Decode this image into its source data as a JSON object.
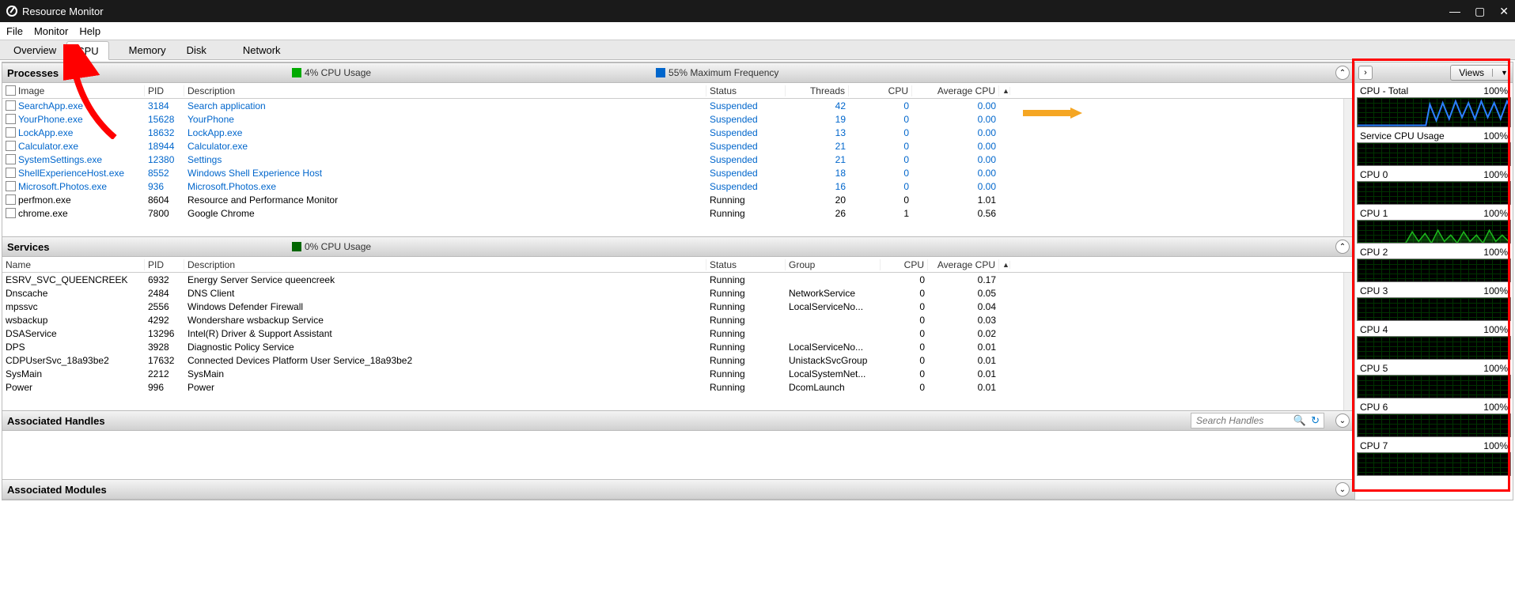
{
  "window": {
    "title": "Resource Monitor"
  },
  "menu": [
    "File",
    "Monitor",
    "Help"
  ],
  "tabs": [
    {
      "label": "Overview",
      "active": false
    },
    {
      "label": "CPU",
      "active": true
    },
    {
      "label": "Memory",
      "active": false
    },
    {
      "label": "Disk",
      "active": false
    },
    {
      "label": "Network",
      "active": false
    }
  ],
  "processes": {
    "title": "Processes",
    "usage": "4% CPU Usage",
    "freq": "55% Maximum Frequency",
    "headers": {
      "image": "Image",
      "pid": "PID",
      "desc": "Description",
      "status": "Status",
      "threads": "Threads",
      "cpu": "CPU",
      "avg": "Average CPU"
    },
    "rows": [
      {
        "image": "SearchApp.exe",
        "pid": "3184",
        "desc": "Search application",
        "status": "Suspended",
        "threads": "42",
        "cpu": "0",
        "avg": "0.00",
        "sus": true
      },
      {
        "image": "YourPhone.exe",
        "pid": "15628",
        "desc": "YourPhone",
        "status": "Suspended",
        "threads": "19",
        "cpu": "0",
        "avg": "0.00",
        "sus": true
      },
      {
        "image": "LockApp.exe",
        "pid": "18632",
        "desc": "LockApp.exe",
        "status": "Suspended",
        "threads": "13",
        "cpu": "0",
        "avg": "0.00",
        "sus": true
      },
      {
        "image": "Calculator.exe",
        "pid": "18944",
        "desc": "Calculator.exe",
        "status": "Suspended",
        "threads": "21",
        "cpu": "0",
        "avg": "0.00",
        "sus": true
      },
      {
        "image": "SystemSettings.exe",
        "pid": "12380",
        "desc": "Settings",
        "status": "Suspended",
        "threads": "21",
        "cpu": "0",
        "avg": "0.00",
        "sus": true
      },
      {
        "image": "ShellExperienceHost.exe",
        "pid": "8552",
        "desc": "Windows Shell Experience Host",
        "status": "Suspended",
        "threads": "18",
        "cpu": "0",
        "avg": "0.00",
        "sus": true
      },
      {
        "image": "Microsoft.Photos.exe",
        "pid": "936",
        "desc": "Microsoft.Photos.exe",
        "status": "Suspended",
        "threads": "16",
        "cpu": "0",
        "avg": "0.00",
        "sus": true
      },
      {
        "image": "perfmon.exe",
        "pid": "8604",
        "desc": "Resource and Performance Monitor",
        "status": "Running",
        "threads": "20",
        "cpu": "0",
        "avg": "1.01",
        "sus": false
      },
      {
        "image": "chrome.exe",
        "pid": "7800",
        "desc": "Google Chrome",
        "status": "Running",
        "threads": "26",
        "cpu": "1",
        "avg": "0.56",
        "sus": false
      }
    ]
  },
  "services": {
    "title": "Services",
    "usage": "0% CPU Usage",
    "headers": {
      "name": "Name",
      "pid": "PID",
      "desc": "Description",
      "status": "Status",
      "group": "Group",
      "cpu": "CPU",
      "avg": "Average CPU"
    },
    "rows": [
      {
        "name": "ESRV_SVC_QUEENCREEK",
        "pid": "6932",
        "desc": "Energy Server Service queencreek",
        "status": "Running",
        "group": "",
        "cpu": "0",
        "avg": "0.17"
      },
      {
        "name": "Dnscache",
        "pid": "2484",
        "desc": "DNS Client",
        "status": "Running",
        "group": "NetworkService",
        "cpu": "0",
        "avg": "0.05"
      },
      {
        "name": "mpssvc",
        "pid": "2556",
        "desc": "Windows Defender Firewall",
        "status": "Running",
        "group": "LocalServiceNo...",
        "cpu": "0",
        "avg": "0.04"
      },
      {
        "name": "wsbackup",
        "pid": "4292",
        "desc": "Wondershare wsbackup Service",
        "status": "Running",
        "group": "",
        "cpu": "0",
        "avg": "0.03"
      },
      {
        "name": "DSAService",
        "pid": "13296",
        "desc": "Intel(R) Driver & Support Assistant",
        "status": "Running",
        "group": "",
        "cpu": "0",
        "avg": "0.02"
      },
      {
        "name": "DPS",
        "pid": "3928",
        "desc": "Diagnostic Policy Service",
        "status": "Running",
        "group": "LocalServiceNo...",
        "cpu": "0",
        "avg": "0.01"
      },
      {
        "name": "CDPUserSvc_18a93be2",
        "pid": "17632",
        "desc": "Connected Devices Platform User Service_18a93be2",
        "status": "Running",
        "group": "UnistackSvcGroup",
        "cpu": "0",
        "avg": "0.01"
      },
      {
        "name": "SysMain",
        "pid": "2212",
        "desc": "SysMain",
        "status": "Running",
        "group": "LocalSystemNet...",
        "cpu": "0",
        "avg": "0.01"
      },
      {
        "name": "Power",
        "pid": "996",
        "desc": "Power",
        "status": "Running",
        "group": "DcomLaunch",
        "cpu": "0",
        "avg": "0.01"
      }
    ]
  },
  "assoc_handles": {
    "title": "Associated Handles",
    "search_placeholder": "Search Handles"
  },
  "assoc_modules": {
    "title": "Associated Modules"
  },
  "rightpane": {
    "views_label": "Views",
    "charts": [
      {
        "label": "CPU - Total",
        "pct": "100%",
        "style": "blue-wave",
        "tall": true
      },
      {
        "label": "Service CPU Usage",
        "pct": "100%"
      },
      {
        "label": "CPU 0",
        "pct": "100%"
      },
      {
        "label": "CPU 1",
        "pct": "100%",
        "style": "green-wave"
      },
      {
        "label": "CPU 2",
        "pct": "100%"
      },
      {
        "label": "CPU 3",
        "pct": "100%"
      },
      {
        "label": "CPU 4",
        "pct": "100%"
      },
      {
        "label": "CPU 5",
        "pct": "100%"
      },
      {
        "label": "CPU 6",
        "pct": "100%"
      },
      {
        "label": "CPU 7",
        "pct": "100%"
      }
    ]
  }
}
